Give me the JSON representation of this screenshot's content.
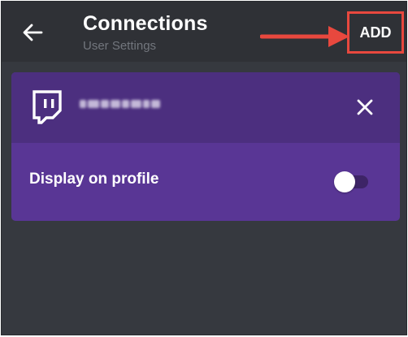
{
  "header": {
    "title": "Connections",
    "subtitle": "User Settings",
    "add_label": "ADD"
  },
  "connection": {
    "service_icon": "twitch-icon",
    "username_redacted": true,
    "display_on_profile_label": "Display on profile",
    "display_on_profile_enabled": false
  },
  "icons": {
    "back": "back-arrow-icon",
    "close": "close-icon",
    "annotation": "red-arrow-annotation"
  },
  "colors": {
    "background": "#36393f",
    "header": "#2f3136",
    "card_top": "#4c2f7f",
    "card_bottom": "#593695",
    "annotation_red": "#e8483e"
  }
}
